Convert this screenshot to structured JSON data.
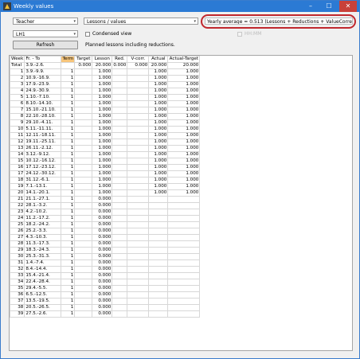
{
  "window": {
    "title": "Weekly values",
    "min": "–",
    "max": "☐",
    "close": "✕"
  },
  "controls": {
    "teacher": "Teacher",
    "view": "Lessons / values",
    "yearly_average": "Yearly average = 0.513 (Lessons + Reductions + ValueCorrection)",
    "element": "LH1",
    "condensed_label": "Condensed view",
    "hhmm_label": "HH:MM",
    "refresh_label": "Refresh",
    "planned_label": "Planned lessons including reductions."
  },
  "table": {
    "headers": [
      "Week",
      "Fr. - To",
      "Term",
      "Target",
      "Lesson",
      "Red.",
      "V-corr.",
      "Actual",
      "Actual-Target"
    ],
    "total": {
      "label": "Total",
      "range": "3.9.-2.6.",
      "term": "",
      "target": "0.000",
      "lesson": "20.000",
      "red": "0.000",
      "vcorr": "0.000",
      "actual": "20.000",
      "diff": "20.000"
    },
    "rows": [
      {
        "week": "1",
        "range": "3.9.-9.9.",
        "term": "1",
        "lesson": "1.000",
        "actual": "1.000",
        "diff": "1.000"
      },
      {
        "week": "2",
        "range": "10.9.-16.9.",
        "term": "1",
        "lesson": "1.000",
        "actual": "1.000",
        "diff": "1.000"
      },
      {
        "week": "3",
        "range": "17.9.-23.9.",
        "term": "1",
        "lesson": "1.000",
        "actual": "1.000",
        "diff": "1.000"
      },
      {
        "week": "4",
        "range": "24.9.-30.9.",
        "term": "1",
        "lesson": "1.000",
        "actual": "1.000",
        "diff": "1.000"
      },
      {
        "week": "5",
        "range": "1.10.-7.10.",
        "term": "1",
        "lesson": "1.000",
        "actual": "1.000",
        "diff": "1.000"
      },
      {
        "week": "6",
        "range": "8.10.-14.10.",
        "term": "1",
        "lesson": "1.000",
        "actual": "1.000",
        "diff": "1.000"
      },
      {
        "week": "7",
        "range": "15.10.-21.10.",
        "term": "1",
        "lesson": "1.000",
        "actual": "1.000",
        "diff": "1.000"
      },
      {
        "week": "8",
        "range": "22.10.-28.10.",
        "term": "1",
        "lesson": "1.000",
        "actual": "1.000",
        "diff": "1.000"
      },
      {
        "week": "9",
        "range": "29.10.-4.11.",
        "term": "1",
        "lesson": "1.000",
        "actual": "1.000",
        "diff": "1.000"
      },
      {
        "week": "10",
        "range": "5.11.-11.11.",
        "term": "1",
        "lesson": "1.000",
        "actual": "1.000",
        "diff": "1.000"
      },
      {
        "week": "11",
        "range": "12.11.-18.11.",
        "term": "1",
        "lesson": "1.000",
        "actual": "1.000",
        "diff": "1.000"
      },
      {
        "week": "12",
        "range": "19.11.-25.11.",
        "term": "1",
        "lesson": "1.000",
        "actual": "1.000",
        "diff": "1.000"
      },
      {
        "week": "13",
        "range": "26.11.-2.12.",
        "term": "1",
        "lesson": "1.000",
        "actual": "1.000",
        "diff": "1.000"
      },
      {
        "week": "14",
        "range": "3.12.-9.12.",
        "term": "1",
        "lesson": "1.000",
        "actual": "1.000",
        "diff": "1.000"
      },
      {
        "week": "15",
        "range": "10.12.-16.12.",
        "term": "1",
        "lesson": "1.000",
        "actual": "1.000",
        "diff": "1.000"
      },
      {
        "week": "16",
        "range": "17.12.-23.12.",
        "term": "1",
        "lesson": "1.000",
        "actual": "1.000",
        "diff": "1.000"
      },
      {
        "week": "17",
        "range": "24.12.-30.12.",
        "term": "1",
        "lesson": "1.000",
        "actual": "1.000",
        "diff": "1.000"
      },
      {
        "week": "18",
        "range": "31.12.-6.1.",
        "term": "1",
        "lesson": "1.000",
        "actual": "1.000",
        "diff": "1.000"
      },
      {
        "week": "19",
        "range": "7.1.-13.1.",
        "term": "1",
        "lesson": "1.000",
        "actual": "1.000",
        "diff": "1.000"
      },
      {
        "week": "20",
        "range": "14.1.-20.1.",
        "term": "1",
        "lesson": "1.000",
        "actual": "1.000",
        "diff": "1.000"
      },
      {
        "week": "21",
        "range": "21.1.-27.1.",
        "term": "1",
        "lesson": "0.000",
        "actual": "",
        "diff": ""
      },
      {
        "week": "22",
        "range": "28.1.-3.2.",
        "term": "1",
        "lesson": "0.000",
        "actual": "",
        "diff": ""
      },
      {
        "week": "23",
        "range": "4.2.-10.2.",
        "term": "1",
        "lesson": "0.000",
        "actual": "",
        "diff": ""
      },
      {
        "week": "24",
        "range": "11.2.-17.2.",
        "term": "1",
        "lesson": "0.000",
        "actual": "",
        "diff": ""
      },
      {
        "week": "25",
        "range": "18.2.-24.2.",
        "term": "1",
        "lesson": "0.000",
        "actual": "",
        "diff": ""
      },
      {
        "week": "26",
        "range": "25.2.-3.3.",
        "term": "1",
        "lesson": "0.000",
        "actual": "",
        "diff": ""
      },
      {
        "week": "27",
        "range": "4.3.-10.3.",
        "term": "1",
        "lesson": "0.000",
        "actual": "",
        "diff": ""
      },
      {
        "week": "28",
        "range": "11.3.-17.3.",
        "term": "1",
        "lesson": "0.000",
        "actual": "",
        "diff": ""
      },
      {
        "week": "29",
        "range": "18.3.-24.3.",
        "term": "1",
        "lesson": "0.000",
        "actual": "",
        "diff": ""
      },
      {
        "week": "30",
        "range": "25.3.-31.3.",
        "term": "1",
        "lesson": "0.000",
        "actual": "",
        "diff": ""
      },
      {
        "week": "31",
        "range": "1.4.-7.4.",
        "term": "1",
        "lesson": "0.000",
        "actual": "",
        "diff": ""
      },
      {
        "week": "32",
        "range": "8.4.-14.4.",
        "term": "1",
        "lesson": "0.000",
        "actual": "",
        "diff": ""
      },
      {
        "week": "33",
        "range": "15.4.-21.4.",
        "term": "1",
        "lesson": "0.000",
        "actual": "",
        "diff": ""
      },
      {
        "week": "34",
        "range": "22.4.-28.4.",
        "term": "1",
        "lesson": "0.000",
        "actual": "",
        "diff": ""
      },
      {
        "week": "35",
        "range": "29.4.-5.5.",
        "term": "1",
        "lesson": "0.000",
        "actual": "",
        "diff": ""
      },
      {
        "week": "36",
        "range": "6.5.-12.5.",
        "term": "1",
        "lesson": "0.000",
        "actual": "",
        "diff": ""
      },
      {
        "week": "37",
        "range": "13.5.-19.5.",
        "term": "1",
        "lesson": "0.000",
        "actual": "",
        "diff": ""
      },
      {
        "week": "38",
        "range": "20.5.-26.5.",
        "term": "1",
        "lesson": "0.000",
        "actual": "",
        "diff": ""
      },
      {
        "week": "39",
        "range": "27.5.-2.6.",
        "term": "1",
        "lesson": "0.000",
        "actual": "",
        "diff": ""
      }
    ]
  },
  "colors": {
    "titlebar": "#2b7ad4",
    "highlight_oval": "#c0282e",
    "term_header": "#f7c57a"
  }
}
